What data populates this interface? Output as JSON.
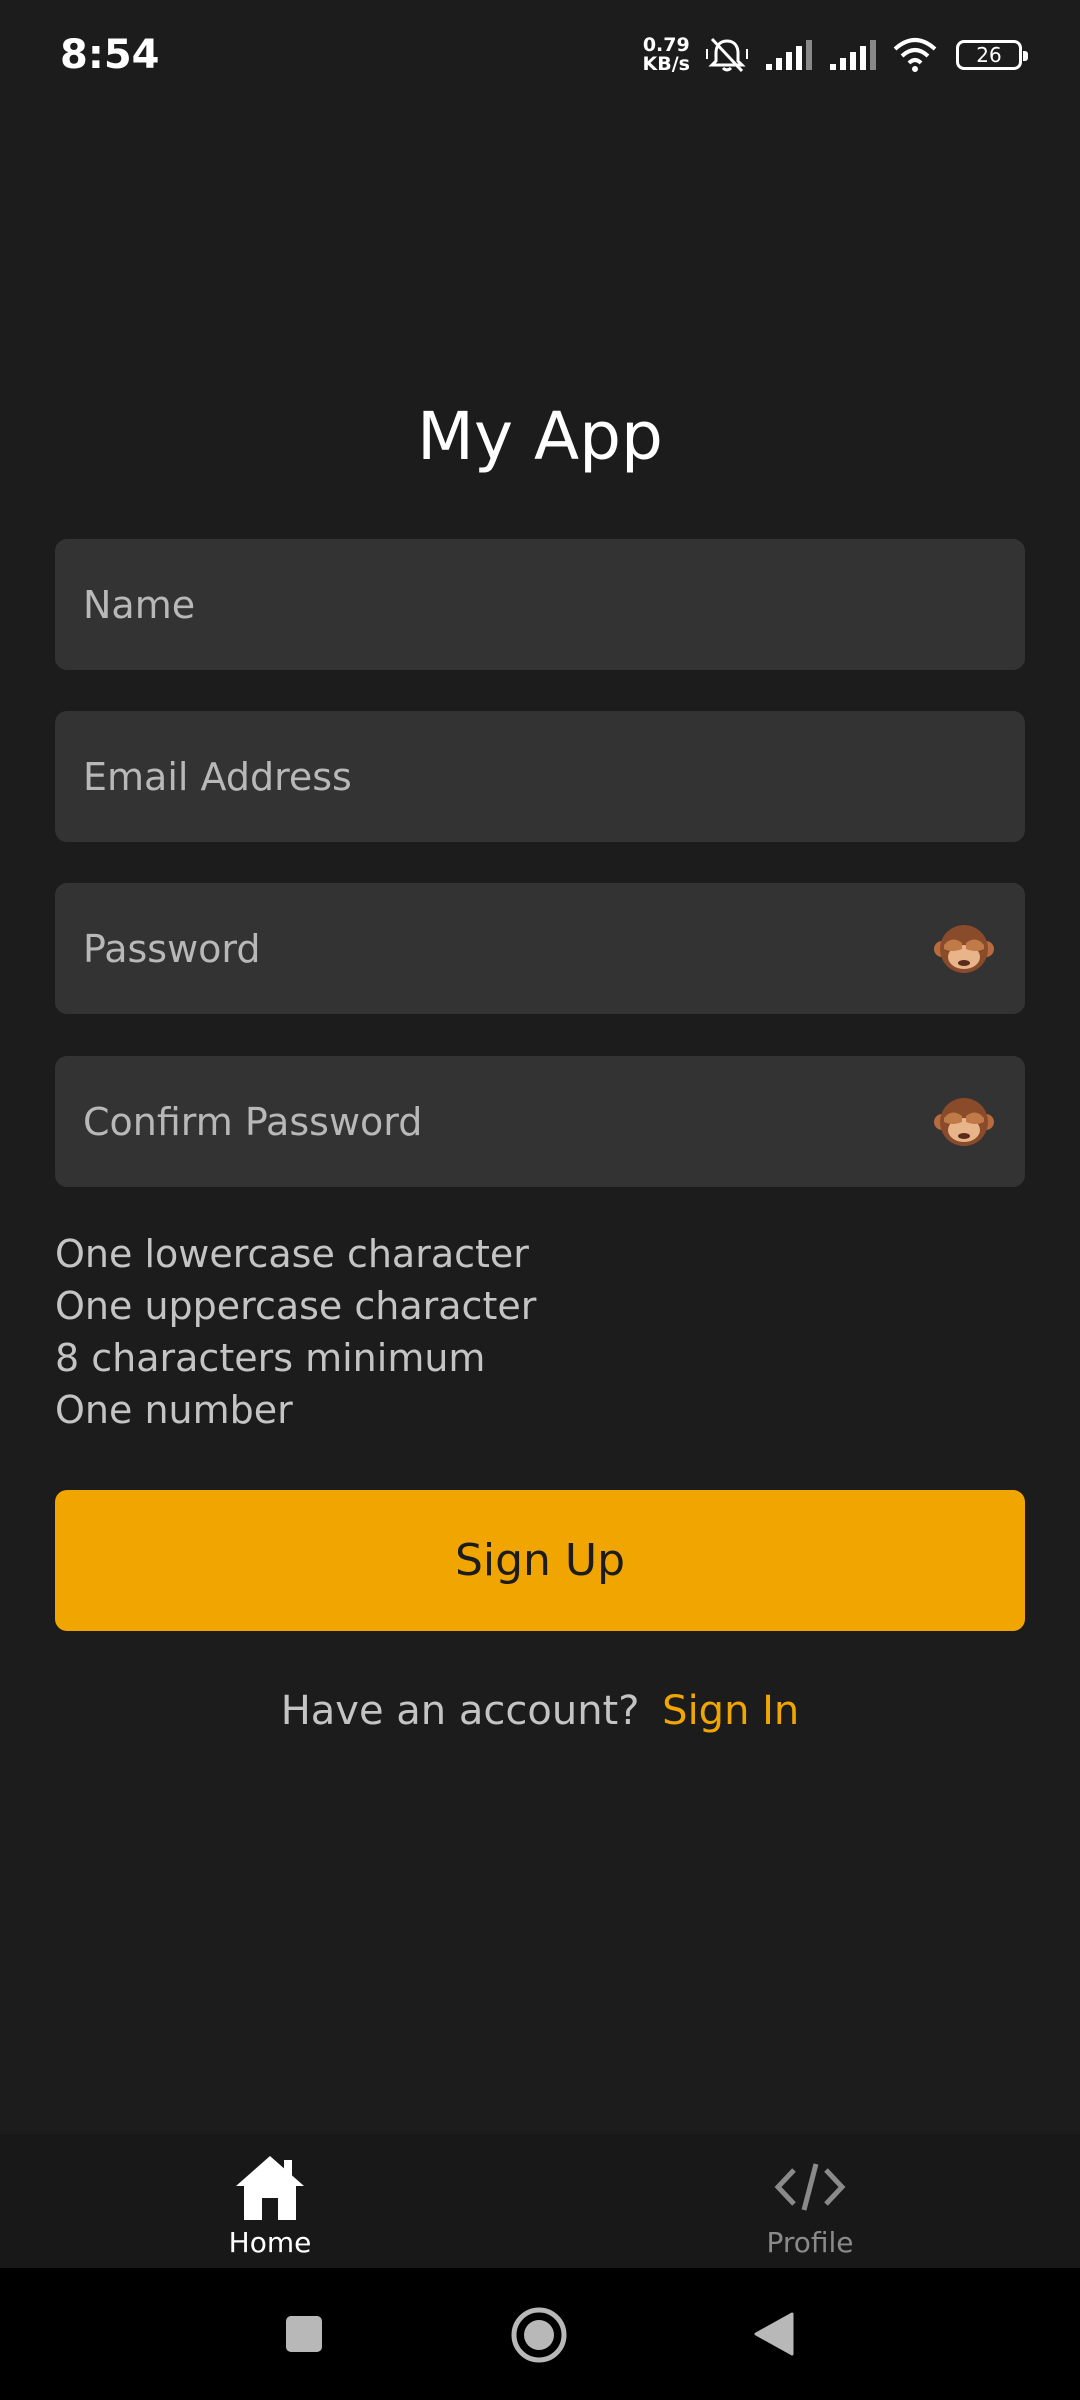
{
  "status_bar": {
    "time": "8:54",
    "net_speed_value": "0.79",
    "net_speed_unit": "KB/s",
    "battery": "26"
  },
  "app": {
    "title": "My App"
  },
  "form": {
    "name_placeholder": "Name",
    "email_placeholder": "Email Address",
    "password_placeholder": "Password",
    "confirm_password_placeholder": "Confirm Password",
    "password_toggle_icon": "see-no-evil-monkey-icon"
  },
  "requirements": [
    "One lowercase character",
    "One uppercase character",
    "8 characters minimum",
    "One number"
  ],
  "actions": {
    "signup_label": "Sign Up",
    "have_account_text": "Have an account?",
    "signin_label": "Sign In"
  },
  "tabs": [
    {
      "label": "Home",
      "icon": "home-icon",
      "active": true
    },
    {
      "label": "Profile",
      "icon": "code-icon",
      "active": false
    }
  ],
  "colors": {
    "background": "#1c1c1c",
    "input_bg": "#333333",
    "accent": "#f0a500",
    "muted_text": "#c4c4c4"
  }
}
